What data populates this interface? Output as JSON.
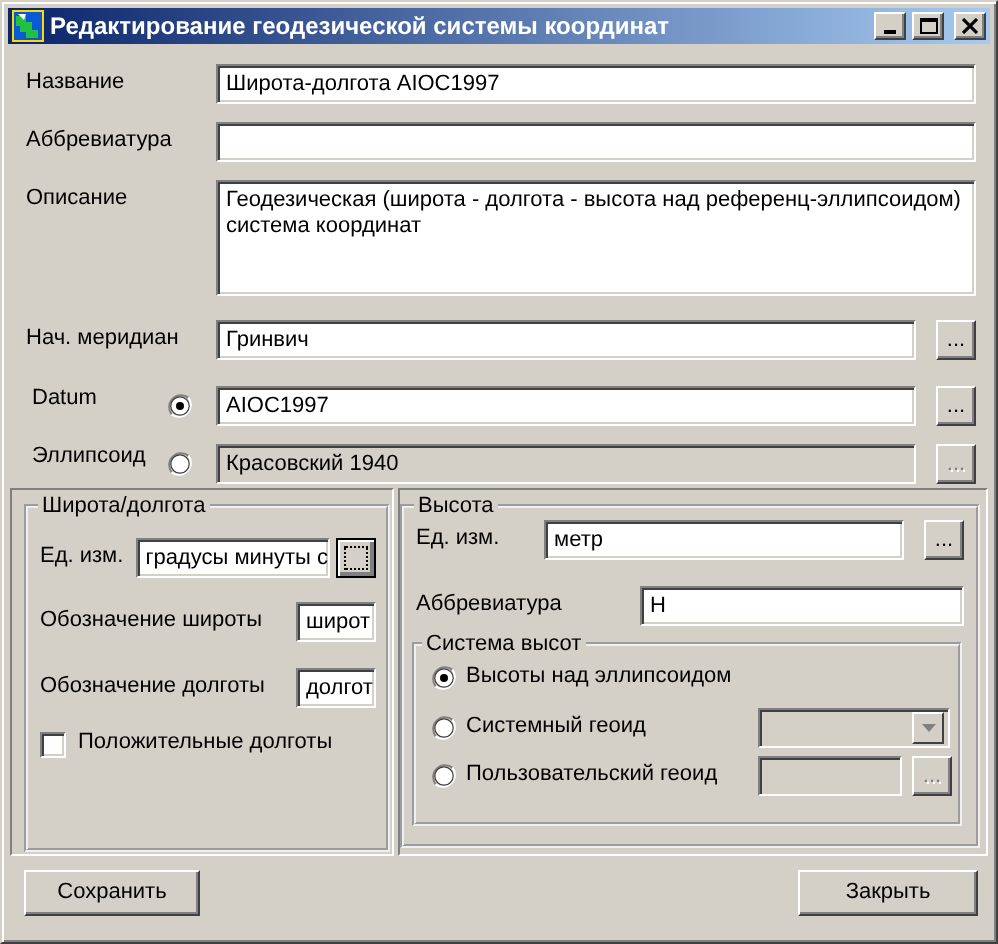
{
  "window": {
    "title": "Редактирование геодезической системы координат"
  },
  "name": {
    "label": "Название",
    "value": "Широта-долгота AIOC1997"
  },
  "abbreviation": {
    "label": "Аббревиатура"
  },
  "description": {
    "label": "Описание",
    "value": "Геодезическая (широта - долгота - высота над референц-эллипсоидом) система координат"
  },
  "meridian": {
    "label": "Нач. меридиан",
    "value": "Гринвич",
    "browse": "..."
  },
  "base": [
    {
      "label": "Datum",
      "value": "AIOC1997",
      "selected": true,
      "browse": "..."
    },
    {
      "label": "Эллипсоид",
      "value": "Красовский 1940",
      "selected": false,
      "browse": "..."
    }
  ],
  "latlon": {
    "title": "Широта/долгота",
    "unit": {
      "label": "Ед. изм.",
      "value": "градусы минуты с",
      "focused": true
    },
    "lat": {
      "label": "Обозначение широты",
      "value": "широт"
    },
    "lon": {
      "label": "Обозначение долготы",
      "value": "долгот"
    },
    "positive": {
      "label": "Положительные долготы",
      "checked": false
    }
  },
  "height": {
    "title": "Высота",
    "unit": {
      "label": "Ед. изм.",
      "value": "метр",
      "browse": "..."
    },
    "abbr": {
      "label": "Аббревиатура",
      "value": "H"
    },
    "system": {
      "title": "Система высот",
      "options": [
        {
          "label": "Высоты над эллипсоидом",
          "selected": true,
          "kind": "plain"
        },
        {
          "label": "Системный геоид",
          "selected": false,
          "kind": "combo"
        },
        {
          "label": "Пользовательский геоид",
          "selected": false,
          "kind": "browse",
          "browse": "..."
        }
      ]
    }
  },
  "buttons": [
    "Сохранить",
    "Закрыть"
  ]
}
